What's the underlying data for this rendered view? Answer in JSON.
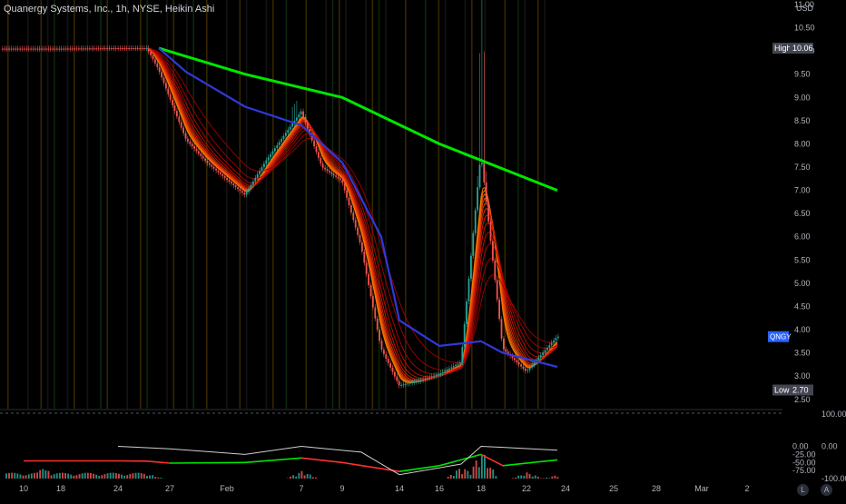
{
  "legend": {
    "text": "Quanergy Systems, Inc., 1h, NYSE, Heikin Ashi"
  },
  "colors": {
    "background": "#000000",
    "axis_text": "#b2b5be",
    "up": "#26a69a",
    "down": "#ef5350",
    "ma_long": "#00e600",
    "ma_blue": "#2f39d9",
    "osc_fast": "#cfcfcf",
    "osc_slow_up": "#00e600",
    "osc_slow_down": "#ff3030",
    "badge_blue": "#2962ff",
    "badge_grey": "#434651"
  },
  "price_axis": {
    "unit": "USD",
    "ticks": [
      "11.00",
      "10.50",
      "10.00",
      "9.50",
      "9.00",
      "8.50",
      "8.00",
      "7.50",
      "7.00",
      "6.50",
      "6.00",
      "5.50",
      "5.00",
      "4.50",
      "4.00",
      "3.50",
      "3.00",
      "2.50"
    ],
    "high_label": "High",
    "high_value": "10.06",
    "low_label": "Low",
    "low_value": "2.70",
    "symbol_badge": "QNGY"
  },
  "osc_axis": {
    "left_ticks": [
      "0.00",
      "-25.00",
      "-50.00",
      "-75.00"
    ],
    "right_ticks": [
      "100.00",
      "0.00",
      "-100.00"
    ]
  },
  "time_axis": {
    "ticks": [
      "10",
      "18",
      "24",
      "27",
      "Feb",
      "7",
      "9",
      "14",
      "16",
      "18",
      "22",
      "24",
      "25",
      "28",
      "Mar",
      "2"
    ]
  },
  "buttons": {
    "log": "L",
    "auto": "A"
  },
  "chart_data": [
    {
      "type": "line",
      "title": "Quanergy Systems, Inc., 1h, NYSE, Heikin Ashi",
      "chart_style": "heikin-ashi candlesticks with moving-average ribbon",
      "ylabel": "USD",
      "ylim": [
        2.3,
        11.0
      ],
      "scale": "linear",
      "grid": false,
      "x_ticks": [
        "10",
        "18",
        "24",
        "27",
        "Feb",
        "7",
        "9",
        "14",
        "16",
        "18",
        "22",
        "24",
        "25",
        "28",
        "Mar",
        "2"
      ],
      "price_x": [
        "Jan 10",
        "Jan 18",
        "Jan 24",
        "Jan 25",
        "Jan 26",
        "Jan 27",
        "Jan 28",
        "Jan 31",
        "Feb 2",
        "Feb 4",
        "Feb 7",
        "Feb 8",
        "Feb 9",
        "Feb 10",
        "Feb 11",
        "Feb 14",
        "Feb 15",
        "Feb 16",
        "Feb 17",
        "Feb 18",
        "Feb 21",
        "Feb 22",
        "Feb 23"
      ],
      "price_y": [
        10.05,
        10.05,
        10.06,
        10.06,
        9.6,
        9.0,
        8.1,
        7.6,
        6.9,
        7.6,
        8.7,
        7.5,
        7.2,
        5.8,
        3.6,
        2.8,
        2.9,
        3.05,
        3.3,
        7.8,
        3.6,
        3.1,
        3.85
      ],
      "high": 10.06,
      "low": 2.7,
      "last": 3.85,
      "series": [
        {
          "name": "",
          "color": "#00e600",
          "x": [
            "Jan 26",
            "Feb 2",
            "Feb 9",
            "Feb 16",
            "Feb 23"
          ],
          "values": [
            10.06,
            9.5,
            9.0,
            8.0,
            7.0
          ]
        },
        {
          "name": "",
          "color": "#2f39d9",
          "x": [
            "Jan 26",
            "Jan 28",
            "Feb 2",
            "Feb 7",
            "Feb 9",
            "Feb 11",
            "Feb 14",
            "Feb 16",
            "Feb 18",
            "Feb 21",
            "Feb 23"
          ],
          "values": [
            10.06,
            9.55,
            8.8,
            8.4,
            7.6,
            6.0,
            4.2,
            3.65,
            3.75,
            3.5,
            3.2
          ]
        }
      ]
    },
    {
      "type": "bar",
      "title": "",
      "x_ticks": [
        "10",
        "18",
        "24",
        "27",
        "Feb",
        "7",
        "9",
        "14",
        "16",
        "18",
        "22",
        "24"
      ],
      "ylim": [
        -100.0,
        100.0
      ],
      "left_scale_ticks": [
        "0.00",
        "-25.00",
        "-50.00",
        "-75.00"
      ],
      "right_scale_ticks": [
        "100.00",
        "0.00",
        "-100.00"
      ],
      "series": [
        {
          "name": "",
          "color": "#cfcfcf",
          "x": [
            "Jan 24",
            "Jan 27",
            "Feb 2",
            "Feb 7",
            "Feb 10",
            "Feb 14",
            "Feb 17",
            "Feb 18",
            "Feb 21",
            "Feb 23"
          ],
          "values": [
            0,
            -8,
            -25,
            0,
            -18,
            -88,
            -55,
            0,
            -3,
            -12
          ]
        },
        {
          "name": "",
          "color": "#ff3030",
          "x": [
            "Jan 10",
            "Jan 24",
            "Jan 25",
            "Jan 27",
            "Feb 2",
            "Feb 7",
            "Feb 9",
            "Feb 14",
            "Feb 16",
            "Feb 18",
            "Feb 21",
            "Feb 23"
          ],
          "values": [
            -45,
            -45,
            -46,
            -52,
            -50,
            -36,
            -50,
            -78,
            -60,
            -25,
            -60,
            -42
          ]
        },
        {
          "name": "",
          "color": "#26a69a",
          "x": [
            "Jan 13",
            "Jan 25",
            "Feb 7",
            "Feb 17",
            "Feb 18",
            "Feb 22",
            "Feb 23"
          ],
          "values": [
            35,
            15,
            25,
            40,
            90,
            20,
            12
          ]
        }
      ]
    }
  ]
}
